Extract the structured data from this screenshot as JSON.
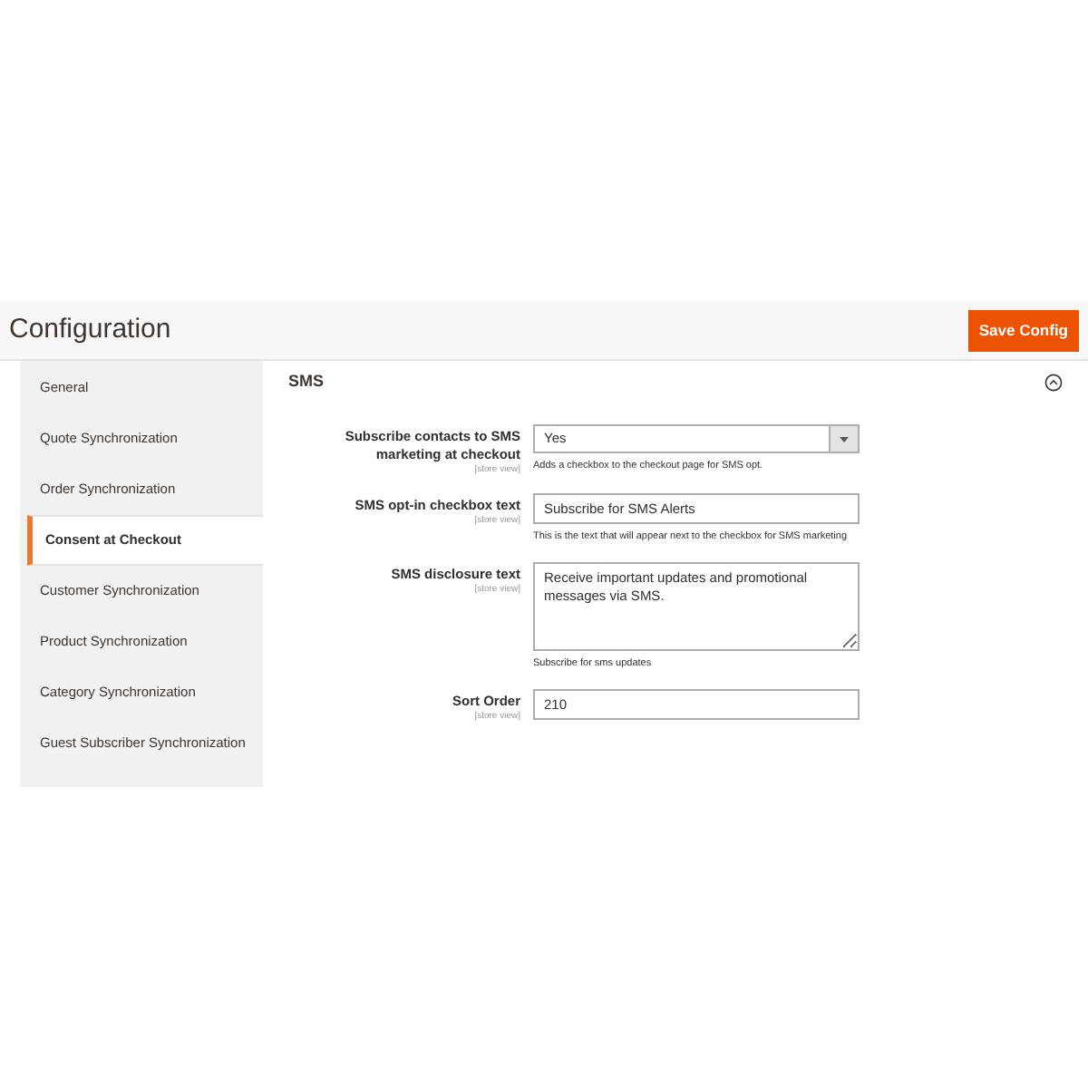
{
  "header": {
    "title": "Configuration",
    "save_button": "Save Config"
  },
  "sidebar": {
    "items": [
      {
        "label": "General",
        "selected": false
      },
      {
        "label": "Quote Synchronization",
        "selected": false
      },
      {
        "label": "Order Synchronization",
        "selected": false
      },
      {
        "label": "Consent at Checkout",
        "selected": true
      },
      {
        "label": "Customer Synchronization",
        "selected": false
      },
      {
        "label": "Product Synchronization",
        "selected": false
      },
      {
        "label": "Category Synchronization",
        "selected": false
      },
      {
        "label": "Guest Subscriber Synchronization",
        "selected": false
      }
    ]
  },
  "section": {
    "title": "SMS",
    "expanded": true,
    "fields": [
      {
        "kind": "select",
        "label": "Subscribe contacts to SMS marketing at checkout",
        "scope": "[store view]",
        "value": "Yes",
        "note": "Adds a checkbox to the checkout page for SMS opt."
      },
      {
        "kind": "text",
        "label": "SMS opt-in checkbox text",
        "scope": "[store view]",
        "value": "Subscribe for SMS Alerts",
        "note": "This is the text that will appear next to the checkbox for SMS marketing"
      },
      {
        "kind": "textarea",
        "label": "SMS disclosure text",
        "scope": "[store view]",
        "value": "Receive important updates and promotional messages via SMS.",
        "note": "Subscribe for sms updates"
      },
      {
        "kind": "text",
        "label": "Sort Order",
        "scope": "[store view]",
        "value": "210"
      }
    ]
  }
}
